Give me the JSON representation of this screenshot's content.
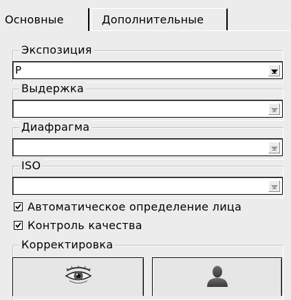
{
  "tabs": {
    "main_label": "Основные",
    "extra_label": "Дополнительные"
  },
  "groups": {
    "exposure": {
      "label": "Экспозиция",
      "value": "P"
    },
    "shutter": {
      "label": "Выдержка",
      "value": ""
    },
    "aperture": {
      "label": "Диафрагма",
      "value": ""
    },
    "iso": {
      "label": "ISO",
      "value": ""
    }
  },
  "checks": {
    "face_detect": {
      "label": "Автоматическое определение лица",
      "checked": true
    },
    "quality": {
      "label": "Контроль качества",
      "checked": true
    }
  },
  "correction": {
    "label": "Корректировка"
  },
  "icons": {
    "eye": "eye-icon",
    "person": "person-icon"
  }
}
